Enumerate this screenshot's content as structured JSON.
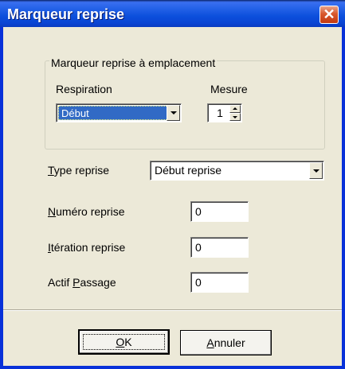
{
  "window": {
    "title": "Marqueur reprise"
  },
  "group": {
    "title": "Marqueur reprise à emplacement",
    "respiration_label": "Respiration",
    "respiration_value": "Début",
    "mesure_label": "Mesure",
    "mesure_value": "1"
  },
  "type_reprise": {
    "label_underlined": "T",
    "label_rest": "ype reprise",
    "value": "Début reprise"
  },
  "numero_reprise": {
    "label_underlined": "N",
    "label_rest": "uméro reprise",
    "value": "0"
  },
  "iteration_reprise": {
    "label_underlined": "I",
    "label_rest": "tération reprise",
    "value": "0"
  },
  "actif_passage": {
    "label_start": "Actif ",
    "label_underlined": "P",
    "label_rest": "assage",
    "value": "0"
  },
  "buttons": {
    "ok_underlined": "O",
    "ok_rest": "K",
    "cancel_underlined": "A",
    "cancel_rest": "nnuler"
  },
  "colors": {
    "title_bar": "#0a45d4",
    "face": "#ece9d8",
    "selection": "#316ac5",
    "close": "#d8582c"
  },
  "icons": {
    "close": "close-icon",
    "dropdown": "chevron-down-icon",
    "spin_up": "spin-up-icon",
    "spin_down": "spin-down-icon"
  }
}
